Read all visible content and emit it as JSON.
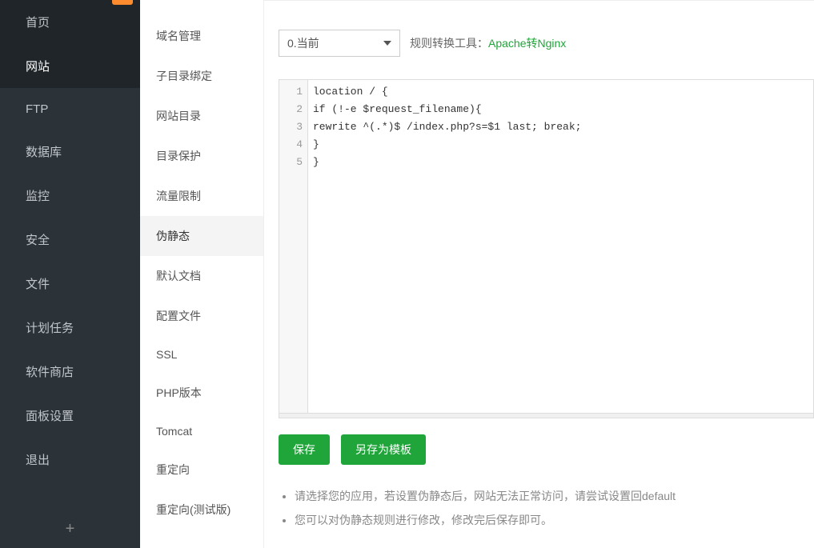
{
  "mainNav": {
    "items": [
      {
        "label": "首页"
      },
      {
        "label": "网站"
      },
      {
        "label": "FTP"
      },
      {
        "label": "数据库"
      },
      {
        "label": "监控"
      },
      {
        "label": "安全"
      },
      {
        "label": "文件"
      },
      {
        "label": "计划任务"
      },
      {
        "label": "软件商店"
      },
      {
        "label": "面板设置"
      },
      {
        "label": "退出"
      }
    ],
    "activeIndex": 1,
    "addLabel": "+"
  },
  "subNav": {
    "items": [
      {
        "label": "域名管理"
      },
      {
        "label": "子目录绑定"
      },
      {
        "label": "网站目录"
      },
      {
        "label": "目录保护"
      },
      {
        "label": "流量限制"
      },
      {
        "label": "伪静态"
      },
      {
        "label": "默认文档"
      },
      {
        "label": "配置文件"
      },
      {
        "label": "SSL"
      },
      {
        "label": "PHP版本"
      },
      {
        "label": "Tomcat"
      },
      {
        "label": "重定向"
      },
      {
        "label": "重定向(测试版)"
      }
    ],
    "activeIndex": 5
  },
  "toolbar": {
    "selectValue": "0.当前",
    "toolLabel": "规则转换工具：",
    "toolLink": "Apache转Nginx"
  },
  "editor": {
    "lines": [
      "location / {",
      "if (!-e $request_filename){",
      "rewrite ^(.*)$ /index.php?s=$1 last; break;",
      "}",
      "}"
    ]
  },
  "buttons": {
    "save": "保存",
    "saveAs": "另存为模板"
  },
  "tips": [
    "请选择您的应用，若设置伪静态后，网站无法正常访问，请尝试设置回default",
    "您可以对伪静态规则进行修改，修改完后保存即可。"
  ]
}
